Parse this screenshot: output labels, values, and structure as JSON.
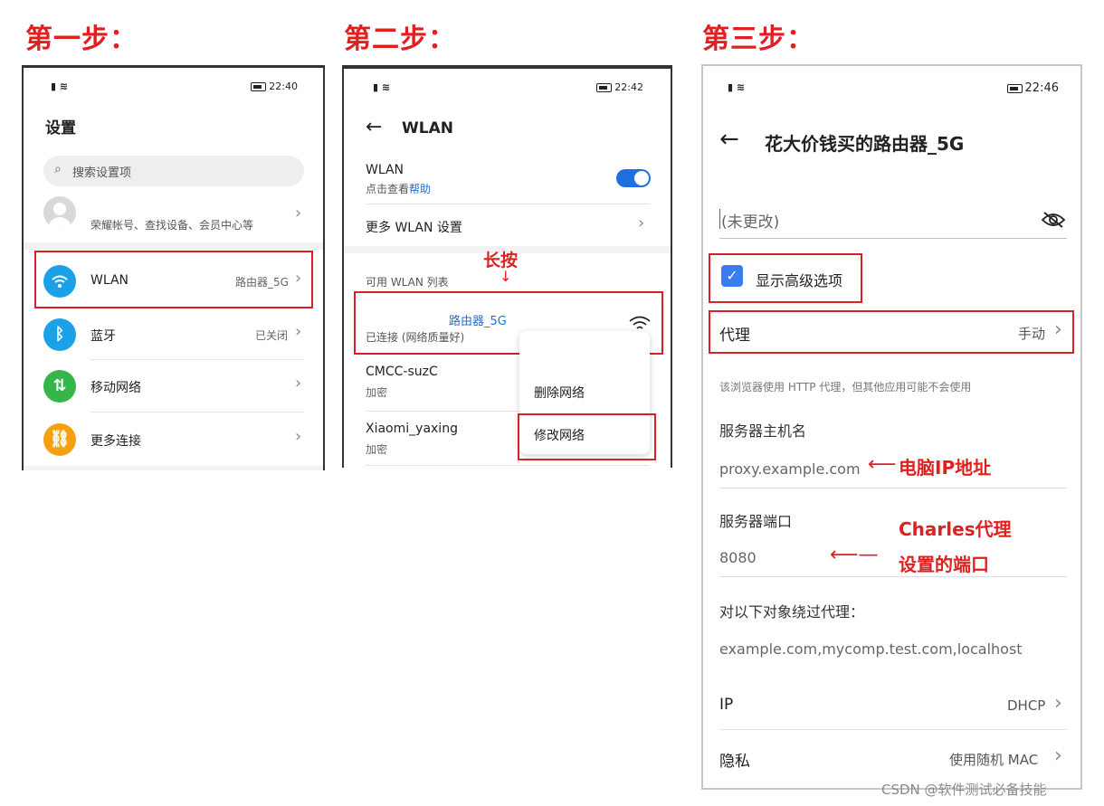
{
  "steps": {
    "one": "第一步：",
    "two": "第二步：",
    "three": "第三步："
  },
  "screen1": {
    "time": "22:40",
    "title": "设置",
    "search_placeholder": "搜索设置项",
    "account_text": "荣耀帐号、查找设备、会员中心等",
    "items": [
      {
        "label": "WLAN",
        "value": "路由器_5G"
      },
      {
        "label": "蓝牙",
        "value": "已关闭"
      },
      {
        "label": "移动网络",
        "value": ""
      },
      {
        "label": "更多连接",
        "value": ""
      }
    ]
  },
  "screen2": {
    "time": "22:42",
    "title": "WLAN",
    "wlan_label": "WLAN",
    "wlan_sub": "点击查看",
    "wlan_help": "帮助",
    "more_settings": "更多 WLAN 设置",
    "available_header": "可用 WLAN 列表",
    "annotation_longpress": "长按",
    "connected_ssid": "路由器_5G",
    "connected_status": "已连接 (网络质量好)",
    "networks": [
      {
        "name": "CMCC-suzC",
        "security": "加密"
      },
      {
        "name": "Xiaomi_yaxing",
        "security": "加密"
      }
    ],
    "context_menu": {
      "delete": "删除网络",
      "modify": "修改网络"
    }
  },
  "screen3": {
    "time": "22:46",
    "title": "花大价钱买的路由器_5G",
    "password_placeholder": "(未更改)",
    "show_advanced": "显示高级选项",
    "proxy_label": "代理",
    "proxy_value": "手动",
    "proxy_note": "该浏览器使用 HTTP 代理，但其他应用可能不会使用",
    "host_label": "服务器主机名",
    "host_value": "proxy.example.com",
    "host_annotation": "电脑IP地址",
    "port_label": "服务器端口",
    "port_value": "8080",
    "port_annotation_1": "Charles代理",
    "port_annotation_2": "设置的端口",
    "bypass_label": "对以下对象绕过代理：",
    "bypass_value": "example.com,mycomp.test.com,localhost",
    "ip_label": "IP",
    "ip_value": "DHCP",
    "privacy_label": "隐私",
    "privacy_value": "使用随机 MAC"
  },
  "watermark": "CSDN @软件测试必备技能",
  "colors": {
    "accent_red": "#d8202a",
    "toggle_blue": "#1f6fe0",
    "wlan_icon": "#1aa1e8",
    "bt_icon": "#1aa1e8",
    "mobile_icon": "#35b64a",
    "more_icon": "#f5a00f"
  },
  "icons": [
    "wifi-icon",
    "bluetooth-icon",
    "mobile-data-icon",
    "link-icon",
    "search-icon",
    "back-arrow-icon",
    "eye-off-icon",
    "checkbox-icon",
    "chevron-right-icon"
  ]
}
